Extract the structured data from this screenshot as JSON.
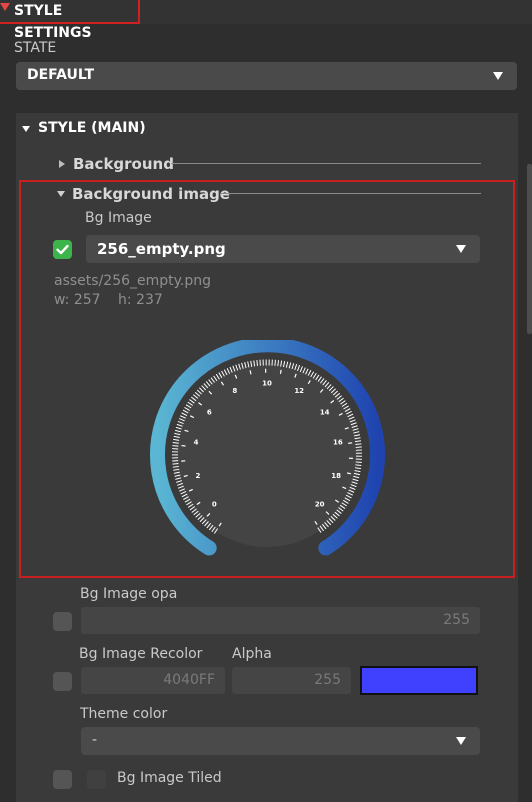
{
  "header": {
    "title": "STYLE SETTINGS"
  },
  "state": {
    "label": "STATE",
    "value": "DEFAULT"
  },
  "style_main": {
    "title": "STYLE (MAIN)"
  },
  "background": {
    "title": "Background"
  },
  "background_image": {
    "title": "Background image",
    "bg_image_label": "Bg Image",
    "file_value": "256_empty.png",
    "path": "assets/256_empty.png",
    "width_text": "w: 257",
    "height_text": "h: 237",
    "preview_ticks": [
      "0",
      "2",
      "4",
      "6",
      "8",
      "10",
      "12",
      "14",
      "16",
      "18",
      "20"
    ]
  },
  "bg_image_opa": {
    "label": "Bg Image opa",
    "value": "255"
  },
  "bg_image_recolor": {
    "label": "Bg Image Recolor",
    "value": "4040FF",
    "swatch_color": "#4040FF"
  },
  "alpha": {
    "label": "Alpha",
    "value": "255"
  },
  "theme_color": {
    "label": "Theme color",
    "value": "-"
  },
  "bg_image_tiled": {
    "label": "Bg Image Tiled"
  }
}
